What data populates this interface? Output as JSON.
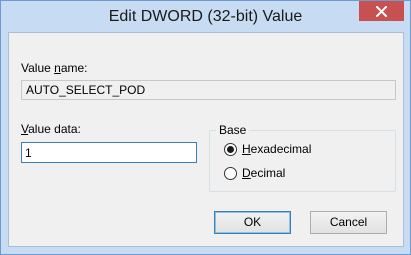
{
  "window": {
    "title": "Edit DWORD (32-bit) Value"
  },
  "value_name": {
    "label_pre": "Value ",
    "label_accel": "n",
    "label_post": "ame:",
    "value": "AUTO_SELECT_POD"
  },
  "value_data": {
    "label_accel": "V",
    "label_post": "alue data:",
    "value": "1"
  },
  "base": {
    "legend": "Base",
    "options": [
      {
        "accel": "H",
        "rest": "exadecimal",
        "selected": true
      },
      {
        "accel": "D",
        "rest": "ecimal",
        "selected": false
      }
    ]
  },
  "buttons": {
    "ok": "OK",
    "cancel": "Cancel"
  },
  "colors": {
    "frame": "#c7dcf2",
    "close": "#c75050",
    "accent": "#3c7fb1"
  }
}
